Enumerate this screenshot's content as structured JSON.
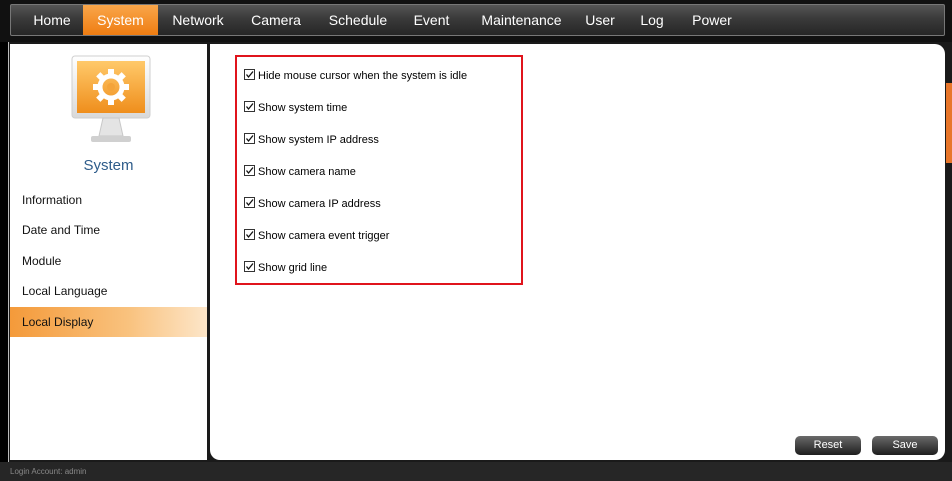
{
  "nav": {
    "items": [
      {
        "label": "Home"
      },
      {
        "label": "System"
      },
      {
        "label": "Network"
      },
      {
        "label": "Camera"
      },
      {
        "label": "Schedule"
      },
      {
        "label": "Event"
      },
      {
        "label": "Maintenance"
      },
      {
        "label": "User"
      },
      {
        "label": "Log"
      },
      {
        "label": "Power"
      }
    ],
    "active": "System"
  },
  "sidebar": {
    "title": "System",
    "icon": "monitor-gear-icon",
    "items": [
      {
        "label": "Information"
      },
      {
        "label": "Date and Time"
      },
      {
        "label": "Module"
      },
      {
        "label": "Local Language"
      },
      {
        "label": "Local Display"
      }
    ],
    "active": "Local Display"
  },
  "options": [
    {
      "label": "Hide mouse cursor when the system is idle",
      "checked": true
    },
    {
      "label": "Show system time",
      "checked": true
    },
    {
      "label": "Show system IP address",
      "checked": true
    },
    {
      "label": "Show camera name",
      "checked": true
    },
    {
      "label": "Show camera IP address",
      "checked": true
    },
    {
      "label": "Show camera event trigger",
      "checked": true
    },
    {
      "label": "Show grid line",
      "checked": true
    }
  ],
  "buttons": {
    "reset_label": "Reset",
    "save_label": "Save"
  },
  "footer": {
    "login_text": "Login Account: admin"
  },
  "colors": {
    "accent": "#ef7d12",
    "highlight_border": "#e0141c",
    "title_blue": "#2e5c8a"
  }
}
